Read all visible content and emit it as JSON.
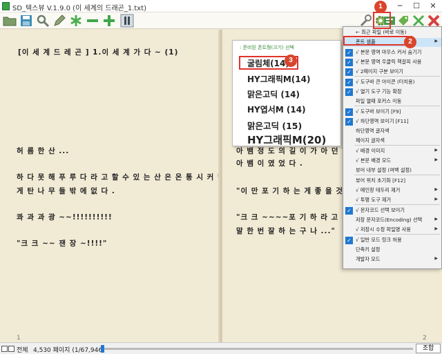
{
  "window": {
    "title": "SD_텍스뷰 V.1.9.0 (이 세계의 드래곤_1.txt)",
    "minimize_glyph": "─",
    "maximize_glyph": "☐",
    "close_glyph": "✕"
  },
  "toolbar": {
    "icons": [
      "folder-open-icon",
      "save-icon",
      "search-icon",
      "pencil-icon",
      "asterisk-icon",
      "minus-icon",
      "plus-icon",
      "pause-icon",
      "wrench-icon",
      "gear-icon",
      "font-settings-icon",
      "tag-icon",
      "expand-icon",
      "close-icon"
    ]
  },
  "left_page": {
    "heading": "[이 세 계 드 레 곤 ] 1.이 세 계 가 다 ~ (1)",
    "lines": [
      "허 름 한 산 ...",
      "하 다 못 해 푸 루 다 라 고 할 수 있 는 산 은 온 통 시 커 먹",
      "게 탄 나 무 들 밖 에 없 다 .",
      "콰 과 과 광 ~~!!!!!!!!!!",
      "\"크 크 ~~ 잰 장 ~!!!!\""
    ],
    "page_number": "1"
  },
  "right_page": {
    "lines": [
      "아 뱀 정 도 의 길 이 가 아 던 한",
      "아 뱀 이 였 었 다 .",
      "\"이 만 포 기 하 는 게 좋 을 것 같",
      "\"크 크 ~~~~포 기 하 라 고 .....치",
      "말 한 번 잘 하 는 구 나 ...\""
    ],
    "page_number": "2"
  },
  "font_panel": {
    "header": ": 준비된 폰트형(크기) 선택",
    "items": [
      "굴림체(14)",
      "HY그래픽M(14)",
      "맑은고딕 (14)",
      "HY엽서M (14)",
      "맑은고딕 (15)",
      "HY그래픽M(20)"
    ]
  },
  "context_menu": {
    "items": [
      {
        "label": "← 최근 파일 (바로 이동)",
        "checked": false,
        "submenu": false
      },
      {
        "label": "폰트 샘플",
        "checked": false,
        "submenu": true
      },
      {
        "label": "√ 본문 영역 마우스 커서 숨기기",
        "checked": true,
        "submenu": false
      },
      {
        "label": "√ 본문 영역 우클릭 책갈피 사용",
        "checked": true,
        "submenu": false
      },
      {
        "label": "√ 2페이지 구분 보이기",
        "checked": true,
        "submenu": false
      },
      {
        "label": "√ 도구바 큰 아이콘 (터치용)",
        "checked": true,
        "submenu": false
      },
      {
        "label": "√ 열기 도구 기능 확장",
        "checked": true,
        "submenu": false
      },
      {
        "label": "파일 열때 포커스 이동",
        "checked": false,
        "submenu": false
      },
      {
        "label": "√ 도구바 보이기 [F9]",
        "checked": true,
        "submenu": false
      },
      {
        "label": "√ 하단영역 보이기 [F11]",
        "checked": true,
        "submenu": false
      },
      {
        "label": "하단영역 글자색",
        "checked": false,
        "submenu": false
      },
      {
        "label": "페이지 글자색",
        "checked": false,
        "submenu": false
      },
      {
        "label": "√ 배경 이미지",
        "checked": false,
        "submenu": true
      },
      {
        "label": "√ 본문 배경 모드",
        "checked": false,
        "submenu": true
      },
      {
        "label": "뷰어 내부 설정 (여백 설정)",
        "checked": false,
        "submenu": false
      },
      {
        "label": "뷰어 위치 초기화 [F12]",
        "checked": false,
        "submenu": false
      },
      {
        "label": "√ 메인창 테두리 제거",
        "checked": false,
        "submenu": true
      },
      {
        "label": "√ 투명 도구 제거",
        "checked": false,
        "submenu": true
      },
      {
        "label": "√ 문자코드 선택 보이기",
        "checked": true,
        "submenu": false
      },
      {
        "label": "저장 문자코드(Encoding) 선택",
        "checked": false,
        "submenu": true
      },
      {
        "label": "√ 저장시 수정 파일명 사용",
        "checked": false,
        "submenu": true
      },
      {
        "label": "√ 일반 모드 링크 허용",
        "checked": true,
        "submenu": false
      },
      {
        "label": "단축키 설정",
        "checked": false,
        "submenu": false
      },
      {
        "label": "개발자 모드",
        "checked": false,
        "submenu": true
      }
    ]
  },
  "markers": [
    "1",
    "2",
    "3"
  ],
  "statusbar": {
    "label": "전체",
    "info": "4,530 페이지 (1/67,946)",
    "combo": "조합",
    "progress": 0.0
  },
  "colors": {
    "accent": "#1f78d1",
    "marker": "#d9452c",
    "highlight": "#e0322b"
  }
}
